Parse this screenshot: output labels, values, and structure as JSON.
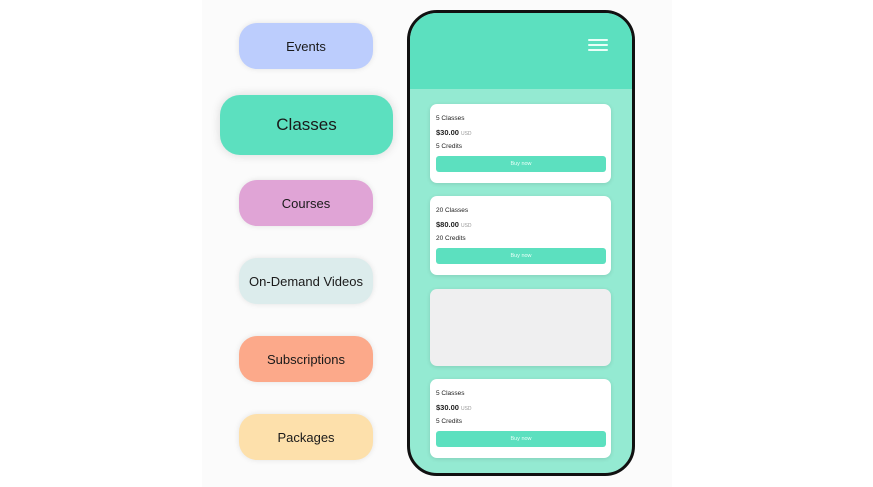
{
  "categories": [
    {
      "label": "Events",
      "color": "#bccdfd"
    },
    {
      "label": "Classes",
      "color": "#5ce0bf"
    },
    {
      "label": "Courses",
      "color": "#e0a4d6"
    },
    {
      "label": "On-Demand Videos",
      "color": "#dcecec"
    },
    {
      "label": "Subscriptions",
      "color": "#fca98a"
    },
    {
      "label": "Packages",
      "color": "#fde0ab"
    }
  ],
  "phone": {
    "header_color": "#5ce0bf",
    "background_color": "#94ead2",
    "cards": [
      {
        "name": "5 Classes",
        "price": "$30.00",
        "currency": "USD",
        "credits": "5 Credits",
        "button": "Buy now"
      },
      {
        "name": "20 Classes",
        "price": "$80.00",
        "currency": "USD",
        "credits": "20 Credits",
        "button": "Buy now"
      },
      {
        "name": "5 Classes",
        "price": "$30.00",
        "currency": "USD",
        "credits": "5 Credits",
        "button": "Buy now"
      }
    ]
  },
  "icons": {
    "menu": "hamburger-menu-icon"
  }
}
